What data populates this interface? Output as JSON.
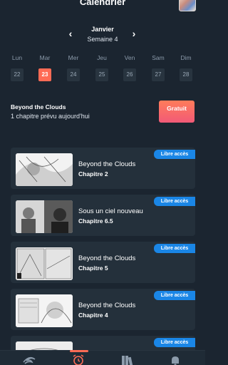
{
  "header": {
    "title": "Calendrier"
  },
  "week": {
    "month": "Janvier",
    "label": "Semaine 4"
  },
  "days": [
    {
      "name": "Lun",
      "date": "22",
      "active": false
    },
    {
      "name": "Mar",
      "date": "23",
      "active": true
    },
    {
      "name": "Mer",
      "date": "24",
      "active": false
    },
    {
      "name": "Jeu",
      "date": "25",
      "active": false
    },
    {
      "name": "Ven",
      "date": "26",
      "active": false
    },
    {
      "name": "Sam",
      "date": "27",
      "active": false
    },
    {
      "name": "Dim",
      "date": "28",
      "active": false
    }
  ],
  "featured": {
    "title": "Beyond the Clouds",
    "subtitle": "1 chapitre prévu aujourd'hui",
    "button_label": "Gratuit"
  },
  "chapters": [
    {
      "title": "Beyond the Clouds",
      "chapter": "Chapitre 2",
      "badge": "Libre accès"
    },
    {
      "title": "Sous un ciel nouveau",
      "chapter": "Chapitre 6.5",
      "badge": "Libre accès"
    },
    {
      "title": "Beyond the Clouds",
      "chapter": "Chapitre 5",
      "badge": "Libre accès"
    },
    {
      "title": "Beyond the Clouds",
      "chapter": "Chapitre 4",
      "badge": "Libre accès"
    },
    {
      "title": "",
      "chapter": "",
      "badge": "Libre accès"
    }
  ],
  "nav": {
    "items": [
      "home-icon",
      "alarm-icon",
      "library-icon",
      "bell-icon"
    ],
    "active": "alarm-icon"
  },
  "colors": {
    "accent": "#ff6b55",
    "badge": "#1a86e6",
    "background": "#1b2530",
    "card": "#24303b"
  }
}
